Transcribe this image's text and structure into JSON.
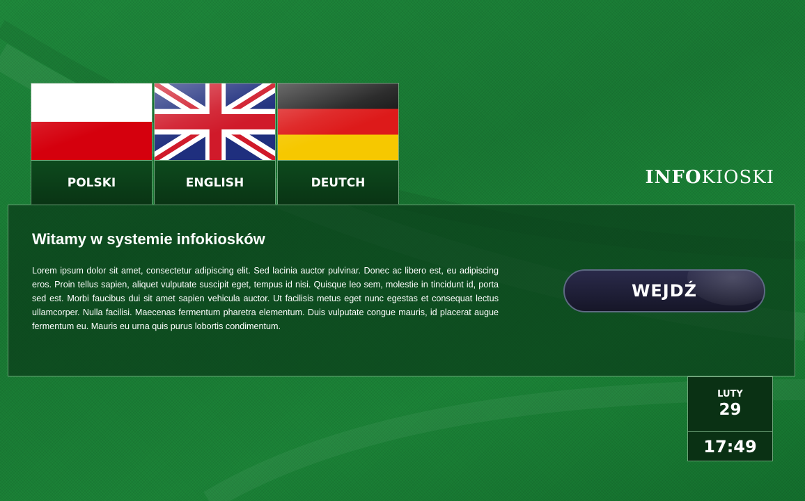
{
  "languages": [
    {
      "label": "POLSKI",
      "flag": "poland-flag"
    },
    {
      "label": "ENGLISH",
      "flag": "uk-flag"
    },
    {
      "label": "DEUTCH",
      "flag": "germany-flag"
    }
  ],
  "brand": {
    "bold": "INFO",
    "light": "KIOSKI"
  },
  "panel": {
    "title": "Witamy w systemie infokiosków",
    "text": "Lorem ipsum dolor sit amet, consectetur adipiscing elit. Sed lacinia auctor pulvinar. Donec ac libero est, eu adipiscing eros. Proin tellus sapien, aliquet vulputate suscipit eget, tempus id nisi. Quisque leo sem, molestie in tincidunt id, porta sed est. Morbi faucibus dui sit amet sapien vehicula auctor. Ut facilisis metus eget nunc egestas et consequat lectus ullamcorper. Nulla facilisi. Maecenas fermentum pharetra elementum. Duis vulputate congue mauris, id placerat augue fermentum eu. Mauris eu urna quis purus lobortis condimentum.",
    "button": "WEJDŹ"
  },
  "clock": {
    "month": "LUTY",
    "day": "29",
    "time": "17:49"
  },
  "colors": {
    "background": "#1c8538",
    "panel": "#0a3c19",
    "border": "#6fa47a",
    "button": "#1e1e36"
  }
}
